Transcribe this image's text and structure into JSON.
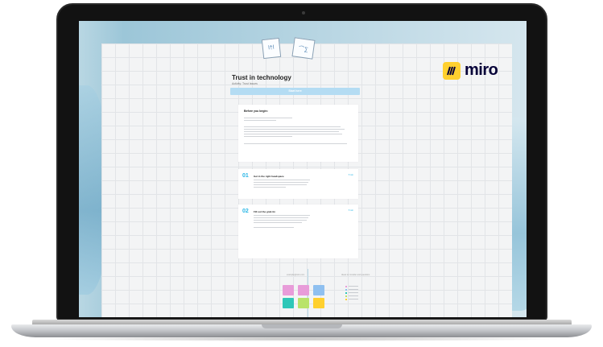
{
  "board": {
    "title": "Trust in technology",
    "subtitle": "Activity: Trust Issues",
    "start_label": "Start here",
    "logo_text": "miro",
    "before_heading": "Before you begin:",
    "step1": {
      "number": "01",
      "title": "Get in the right headspace",
      "badge": "5 min"
    },
    "step2": {
      "number": "02",
      "title": "Fill out the grab tin",
      "badge": "5 min"
    },
    "captions": [
      "example@miro.com",
      "Ideas to consider and questions"
    ]
  },
  "colors": {
    "accent": "#29b6e6",
    "brand": "#ffd02f",
    "start": "#b4dcf3"
  },
  "stickies": [
    "#e89cd9",
    "#e89cd9",
    "#8fc0f0",
    "#2ec7b8",
    "#b9e36a",
    "#ffd02f"
  ]
}
